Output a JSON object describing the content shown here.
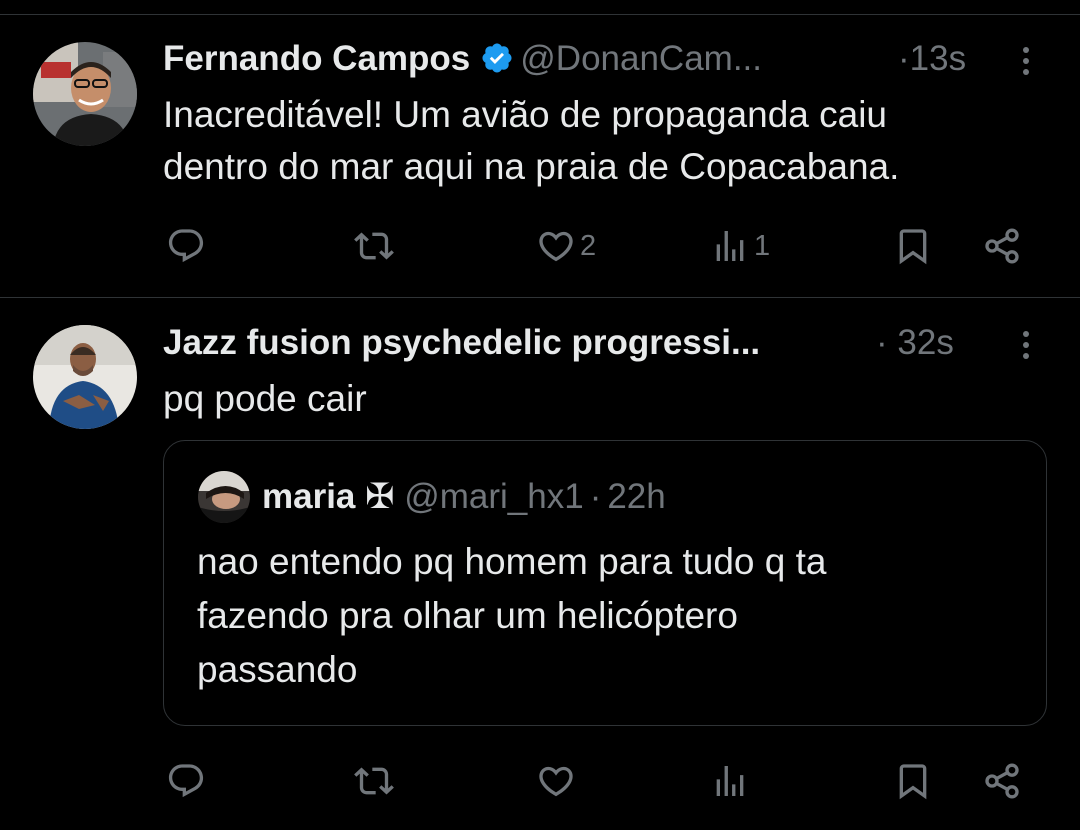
{
  "tweets": [
    {
      "author_name": "Fernando Campos",
      "handle": "@DonanCam...",
      "separator": "·",
      "time": "13s",
      "verified": true,
      "text_line1": "Inacreditável! Um avião de propaganda caiu",
      "text_line2": "dentro do mar aqui na praia de Copacabana.",
      "actions": {
        "reply_count": "",
        "retweet_count": "",
        "like_count": "2",
        "views_count": "1"
      }
    },
    {
      "author_name": "Jazz fusion psychedelic progressi...",
      "separator": "·",
      "time": "32s",
      "text": "pq pode cair",
      "actions": {
        "reply_count": "",
        "retweet_count": "",
        "like_count": "",
        "views_count": ""
      },
      "quote": {
        "author_name": "maria",
        "name_symbol": "✠",
        "handle": "@mari_hx1",
        "separator": "·",
        "time": "22h",
        "text_line1": "nao entendo pq homem para tudo q ta",
        "text_line2": "fazendo pra olhar um helicóptero",
        "text_line3": "passando"
      }
    }
  ],
  "colors": {
    "background": "#000000",
    "text": "#e7e9ea",
    "muted": "#71767b",
    "verified": "#1d9bf0",
    "divider": "#2f3336"
  },
  "icons": [
    "reply-icon",
    "retweet-icon",
    "like-icon",
    "views-icon",
    "bookmark-icon",
    "share-icon",
    "more-icon",
    "verified-badge-icon"
  ]
}
